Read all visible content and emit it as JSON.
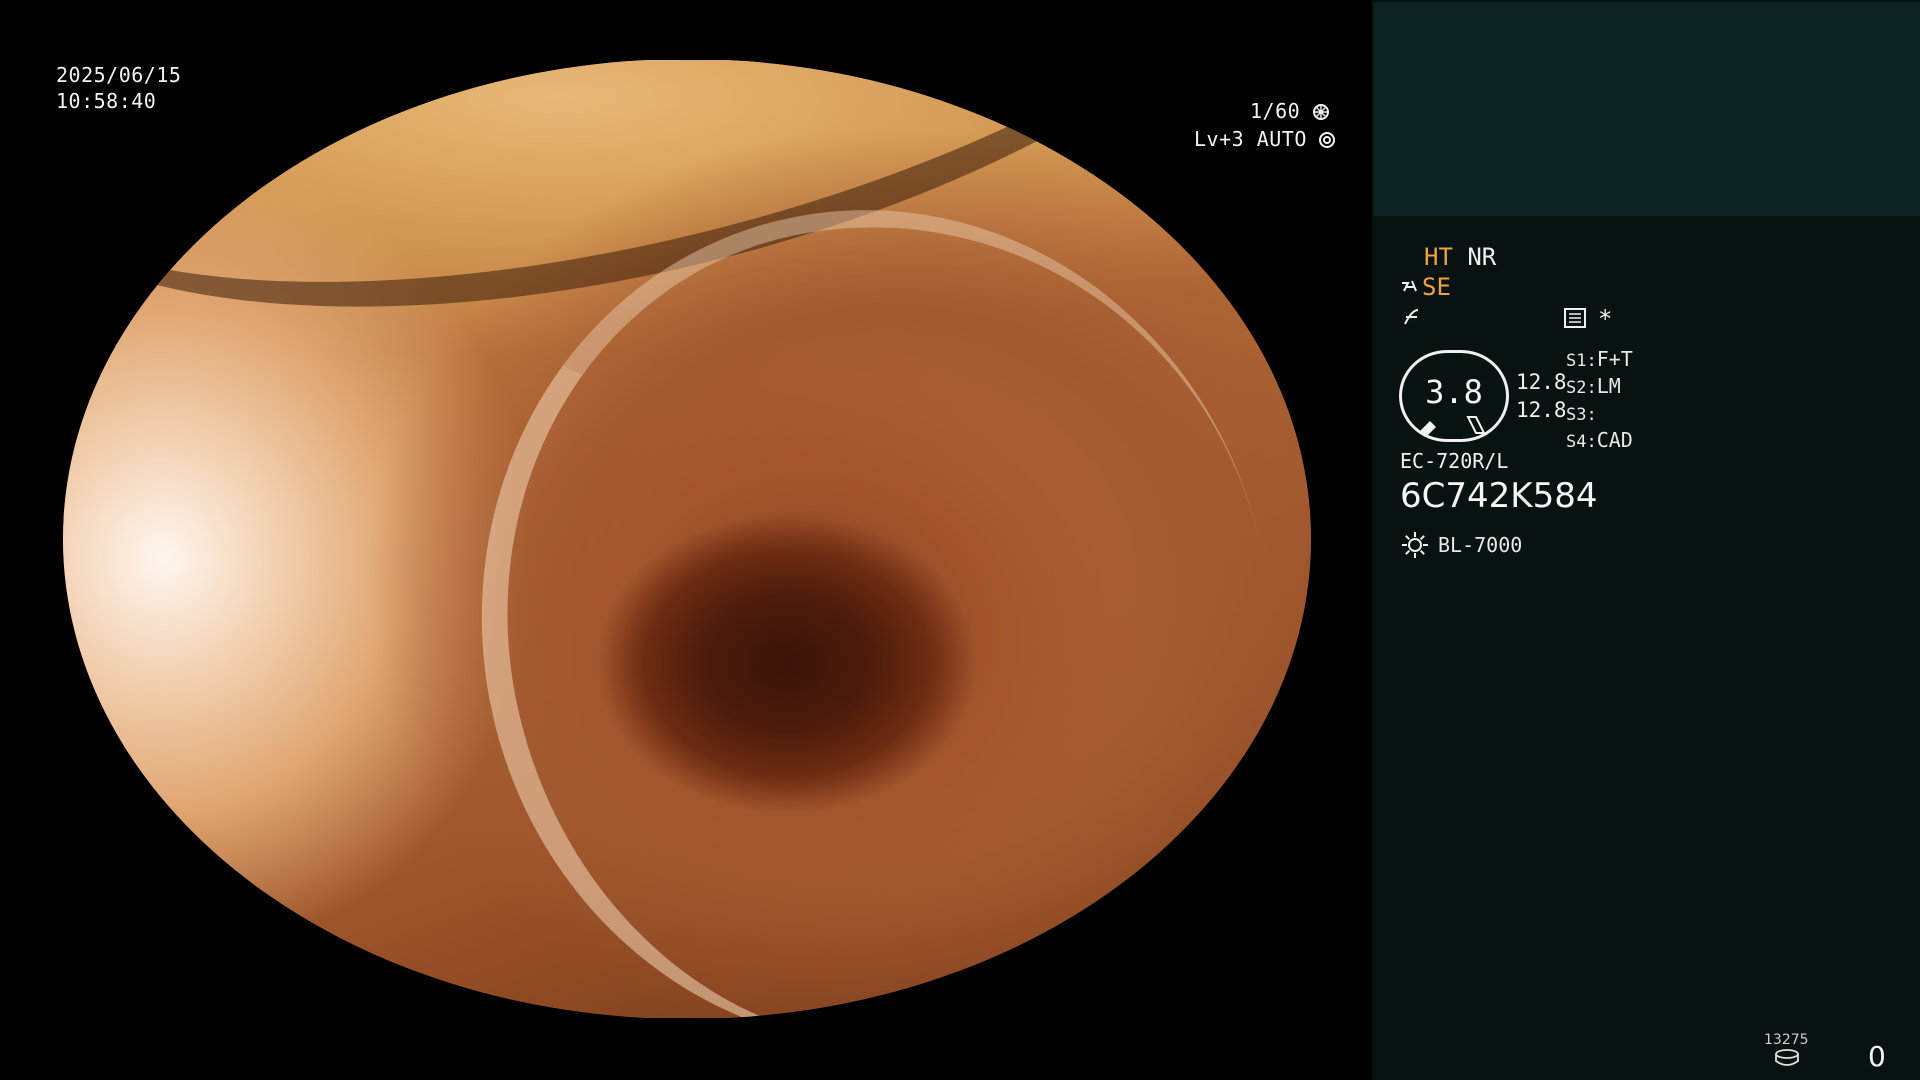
{
  "overlay": {
    "date": "2025/06/15",
    "time": "10:58:40",
    "shutter": "1/60",
    "level": "Lv+3",
    "mode": "AUTO"
  },
  "panel": {
    "ht": "HT",
    "nr": "NR",
    "se": "SE",
    "asterisk": "*",
    "gauge_value": "3.8",
    "left_value_1": "12.8",
    "left_value_2": "12.8",
    "switches": [
      {
        "key": "S1:",
        "value": "F+T"
      },
      {
        "key": "S2:",
        "value": "LM"
      },
      {
        "key": "S3:",
        "value": ""
      },
      {
        "key": "S4:",
        "value": "CAD"
      }
    ],
    "scope_model": "EC-720R/L",
    "serial": "6C742K584",
    "light_source": "BL-7000",
    "counter": "13275",
    "count": "0"
  },
  "colors": {
    "accent": "#f2a23a",
    "panel_bg": "#071212",
    "panel_top_bg": "#0d2222"
  },
  "icons": {
    "shutter": "aperture-icon",
    "mode": "iris-icon",
    "se": "enhance-icon",
    "f": "function-icon",
    "menu": "menu-icon",
    "light": "light-icon",
    "storage": "storage-icon"
  }
}
